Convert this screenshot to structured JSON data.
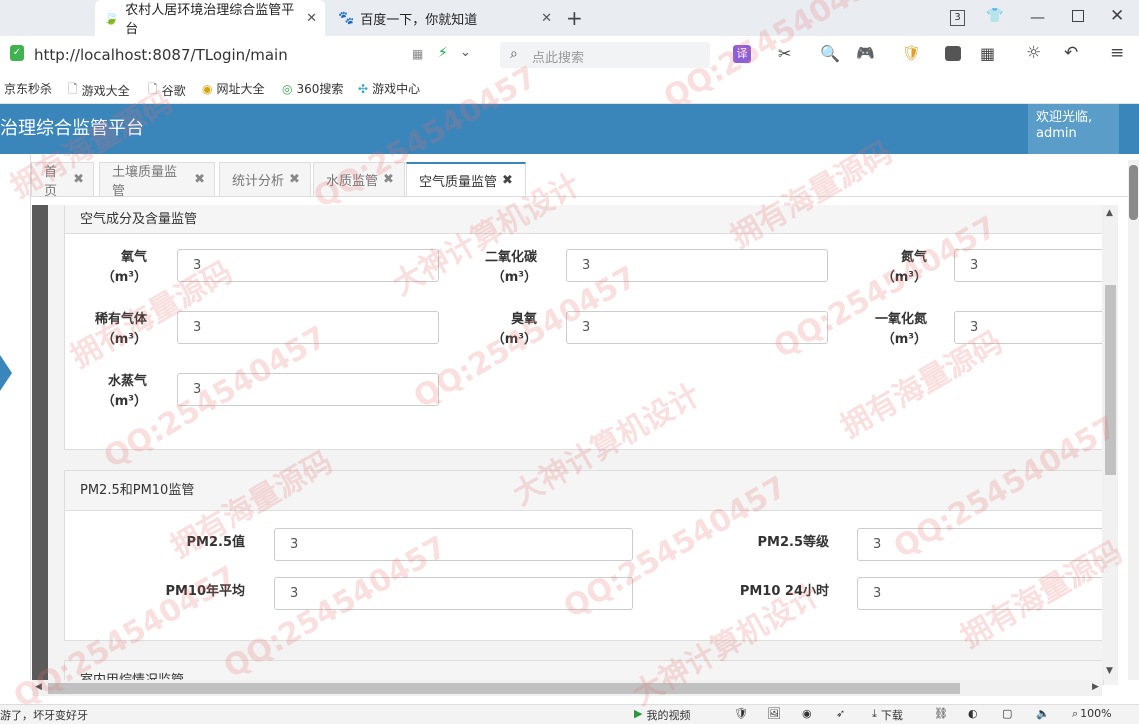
{
  "browser": {
    "tabs": [
      {
        "title": "农村人居环境治理综合监管平台",
        "active": true
      },
      {
        "title": "百度一下，你就知道",
        "active": false
      }
    ],
    "address": "http://localhost:8087/TLogin/main",
    "search_placeholder": "点此搜索",
    "tab_count": "3",
    "bookmarks": [
      "京东秒杀",
      "游戏大全",
      "谷歌",
      "网址大全",
      "360搜索",
      "游戏中心"
    ]
  },
  "app": {
    "title": "治理综合监管平台",
    "welcome": "欢迎光临,",
    "user": "admin"
  },
  "content_tabs": [
    {
      "label": "首页",
      "active": false
    },
    {
      "label": "土壤质量监管",
      "active": false
    },
    {
      "label": "统计分析",
      "active": false
    },
    {
      "label": "水质监管",
      "active": false
    },
    {
      "label": "空气质量监管",
      "active": true
    }
  ],
  "panel_air": {
    "title": "空气成分及含量监管",
    "fields": [
      {
        "label": "氧气",
        "unit": "（m³）",
        "value": "3"
      },
      {
        "label": "二氧化碳",
        "unit": "（m³）",
        "value": "3"
      },
      {
        "label": "氮气",
        "unit": "（m³）",
        "value": "3"
      },
      {
        "label": "稀有气体",
        "unit": "（m³）",
        "value": "3"
      },
      {
        "label": "臭氧",
        "unit": "（m³）",
        "value": "3"
      },
      {
        "label": "一氧化氮",
        "unit": "（m³）",
        "value": "3"
      },
      {
        "label": "水蒸气",
        "unit": "（m³）",
        "value": "3"
      }
    ]
  },
  "panel_pm": {
    "title": "PM2.5和PM10监管",
    "fields": [
      {
        "label": "PM2.5值",
        "value": "3"
      },
      {
        "label": "PM2.5等级",
        "value": "3"
      },
      {
        "label": "PM10年平均",
        "value": "3"
      },
      {
        "label": "PM10 24小时",
        "value": "3"
      }
    ]
  },
  "panel_next": {
    "title": "室内甲烷情况监管"
  },
  "statusbar": {
    "left": "游了，坏牙变好牙",
    "video": "我的视频",
    "download": "下载",
    "zoom": "100%"
  },
  "watermarks": [
    "拥有海量源码",
    "大神计算机设计",
    "QQ:254540457"
  ]
}
